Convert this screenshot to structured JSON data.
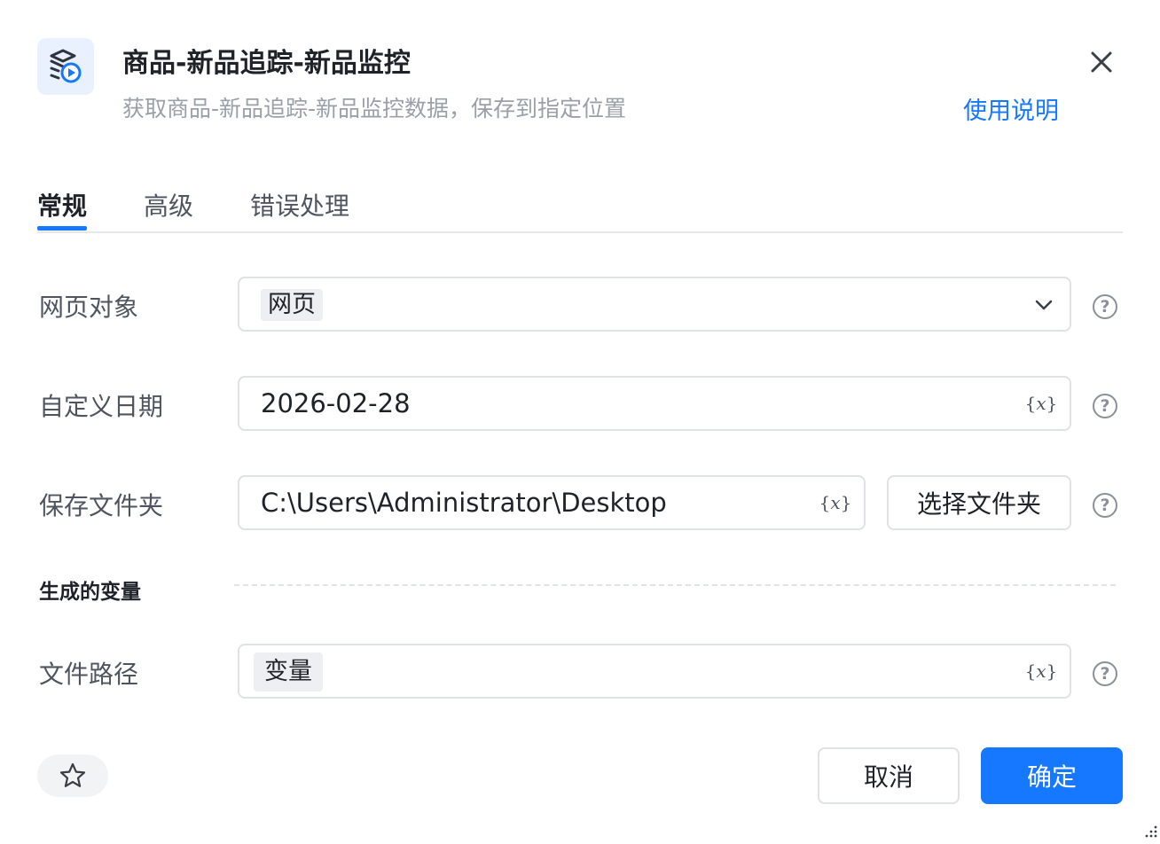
{
  "header": {
    "icon": "layers-play-icon",
    "title": "商品-新品追踪-新品监控",
    "subtitle": "获取商品-新品追踪-新品监控数据，保存到指定位置",
    "help_link": "使用说明",
    "close_icon": "close-icon"
  },
  "tabs": [
    {
      "label": "常规",
      "active": true
    },
    {
      "label": "高级",
      "active": false
    },
    {
      "label": "错误处理",
      "active": false
    }
  ],
  "form": {
    "webpage_object": {
      "label": "网页对象",
      "value": "网页"
    },
    "custom_date": {
      "label": "自定义日期",
      "value": "2026-02-28"
    },
    "save_folder": {
      "label": "保存文件夹",
      "value": "C:\\Users\\Administrator\\Desktop",
      "button": "选择文件夹"
    },
    "variable_icon_text": "{𝑥}",
    "help_glyph": "?"
  },
  "generated_vars": {
    "section_title": "生成的变量",
    "file_path": {
      "label": "文件路径",
      "value": "变量"
    }
  },
  "footer": {
    "cancel": "取消",
    "confirm": "确定"
  },
  "colors": {
    "accent": "#1677ff",
    "icon_bg": "#e9f1ff"
  }
}
